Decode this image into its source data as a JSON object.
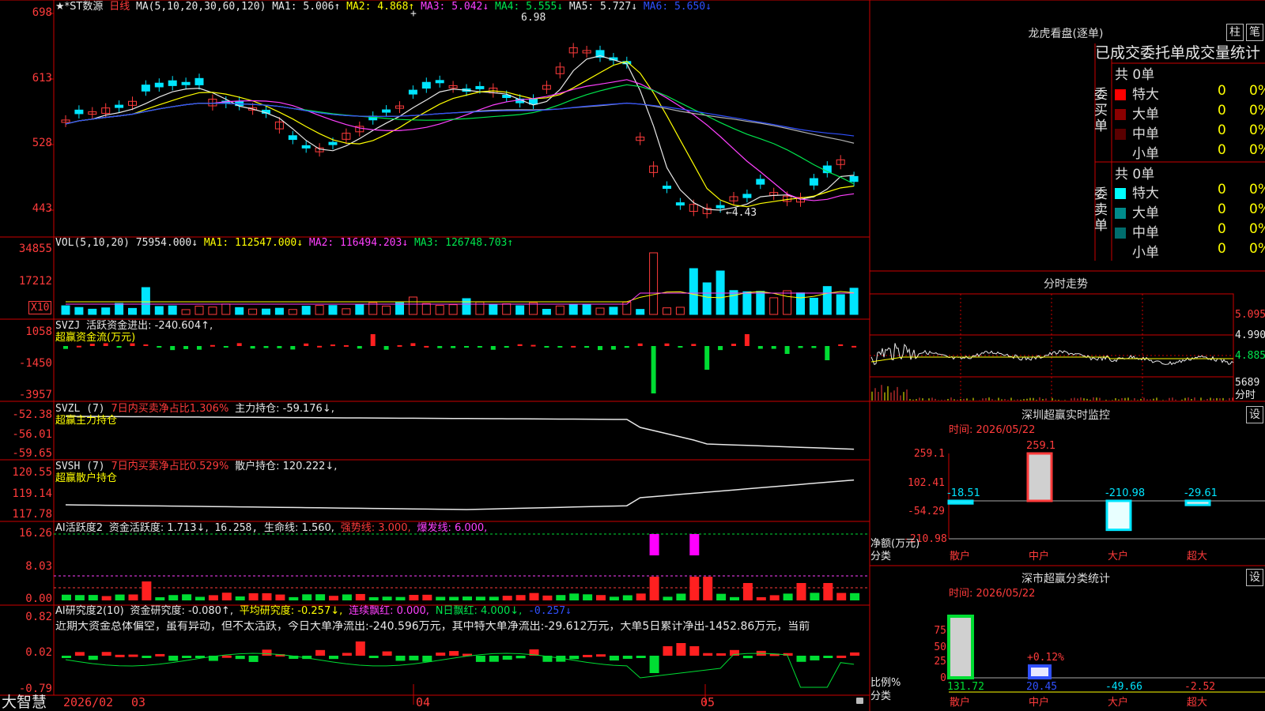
{
  "app": {
    "brand": "大智慧"
  },
  "kline": {
    "header": {
      "code": "★*ST数源",
      "period": "日线",
      "ma": "MA(5,10,20,30,60,120)",
      "ma1": "MA1: 5.006↑",
      "ma2": "MA2: 4.868↑",
      "ma3": "MA3: 5.042↓",
      "ma4": "MA4: 5.555↓",
      "ma5": "MA5: 5.727↓",
      "ma6": "MA6: 5.650↓"
    },
    "yticks": [
      "698",
      "613",
      "528",
      "443"
    ],
    "high_label": "6.98",
    "low_label": "←4.43",
    "plus_marker": "+"
  },
  "volume": {
    "header": {
      "name": "VOL(5,10,20)",
      "val": "75954.000↓",
      "ma1": "MA1: 112547.000↓",
      "ma2": "MA2: 116494.203↓",
      "ma3": "MA3: 126748.703↑"
    },
    "yticks": [
      "34855",
      "17212"
    ],
    "unit": "X10"
  },
  "svzj": {
    "header": {
      "name": "SVZJ",
      "label": "活跃资金进出: -240.604↑,",
      "sub": "超赢资金流(万元)"
    },
    "yticks": [
      "1058",
      "-1450",
      "-3957"
    ]
  },
  "svzl": {
    "header": {
      "name": "SVZL (7)",
      "pct": "7日内买卖净占比1.306%",
      "hold": "主力持仓: -59.176↓,",
      "sub": "超赢主力持仓"
    },
    "yticks": [
      "-52.38",
      "-56.01",
      "-59.65"
    ]
  },
  "svsh": {
    "header": {
      "name": "SVSH (7)",
      "pct": "7日内买卖净占比0.529%",
      "hold": "散户持仓: 120.222↓,",
      "sub": "超赢散户持仓"
    },
    "yticks": [
      "120.55",
      "119.14",
      "117.78"
    ]
  },
  "ai_active": {
    "header": {
      "name": "AI活跃度2",
      "a": "资金活跃度: 1.713↓,",
      "b": "16.258,",
      "c": "生命线: 1.560,",
      "d": "强势线: 3.000,",
      "e": "爆发线: 6.000,"
    },
    "yticks": [
      "16.26",
      "8.03",
      "0.00"
    ]
  },
  "ai_research": {
    "header": {
      "name": "AI研究度2(10)",
      "a": "资金研究度: -0.080↑,",
      "b": "平均研究度: -0.257↓,",
      "c": "连续飘红: 0.000,",
      "d": "N日飘红: 4.000↓,",
      "e": "-0.257↓"
    },
    "yticks": [
      "0.82",
      "0.02",
      "-0.79"
    ],
    "comment": "近期大资金总体偏空，虽有异动，但不太活跃，今日大单净流出:-240.596万元，其中特大单净流出:-29.612万元，大单5日累计净出-1452.86万元，当前"
  },
  "xaxis": {
    "labels": [
      "2026/02",
      "03",
      "04",
      "05"
    ]
  },
  "right": {
    "lhk": {
      "title": "龙虎看盘(逐单)",
      "btn1": "柱",
      "btn2": "笔",
      "subtitle": "已成交委托单成交量统计",
      "buy_side": "委买单",
      "sell_side": "委卖单",
      "buy_total": "共 0单",
      "sell_total": "共 0单",
      "buy_rows": [
        {
          "label": "特大",
          "v": "0",
          "p": "0%",
          "color": "#ff0000"
        },
        {
          "label": "大单",
          "v": "0",
          "p": "0%",
          "color": "#8b0000"
        },
        {
          "label": "中单",
          "v": "0",
          "p": "0%",
          "color": "#5a0000"
        },
        {
          "label": "小单",
          "v": "0",
          "p": "0%",
          "color": ""
        }
      ],
      "sell_rows": [
        {
          "label": "特大",
          "v": "0",
          "p": "0%",
          "color": "#00ffff"
        },
        {
          "label": "大单",
          "v": "0",
          "p": "0%",
          "color": "#008b8b"
        },
        {
          "label": "中单",
          "v": "0",
          "p": "0%",
          "color": "#006d6d"
        },
        {
          "label": "小单",
          "v": "0",
          "p": "0%",
          "color": ""
        }
      ]
    },
    "intraday": {
      "title": "分时走势",
      "yticks": [
        "5.095",
        "4.990",
        "4.885",
        "5689"
      ],
      "unit": "分时"
    },
    "monitor": {
      "title": "深圳超赢实时监控",
      "btn": "设",
      "time": "时间: 2026/05/22",
      "yticks": [
        "259.1",
        "102.41",
        "-54.29",
        "-210.98"
      ],
      "ylabel": "净额(万元)",
      "xlabel": "分类",
      "categories": [
        "散户",
        "中户",
        "大户",
        "超大"
      ],
      "values": [
        "-18.51",
        "259.1",
        "-210.98",
        "-29.61"
      ]
    },
    "classstat": {
      "title": "深市超赢分类统计",
      "btn": "设",
      "time": "时间: 2026/05/22",
      "yticks": [
        "75",
        "50",
        "25",
        "0"
      ],
      "ylabel": "比例%",
      "xlabel": "分类",
      "categories": [
        "散户",
        "中户",
        "大户",
        "超大"
      ],
      "values": [
        "131.72",
        "20.45",
        "-49.66",
        "-2.52"
      ],
      "annot": "+0.12%"
    }
  },
  "colors": {
    "up": "#ff3b3b",
    "down": "#00e5ff",
    "grid": "#cc0000",
    "ma1": "#e8e8e8",
    "ma2": "#ffff00",
    "ma3": "#ff40ff",
    "ma4": "#00e64d",
    "ma5": "#b0b0b0",
    "ma6": "#3050ff"
  }
}
